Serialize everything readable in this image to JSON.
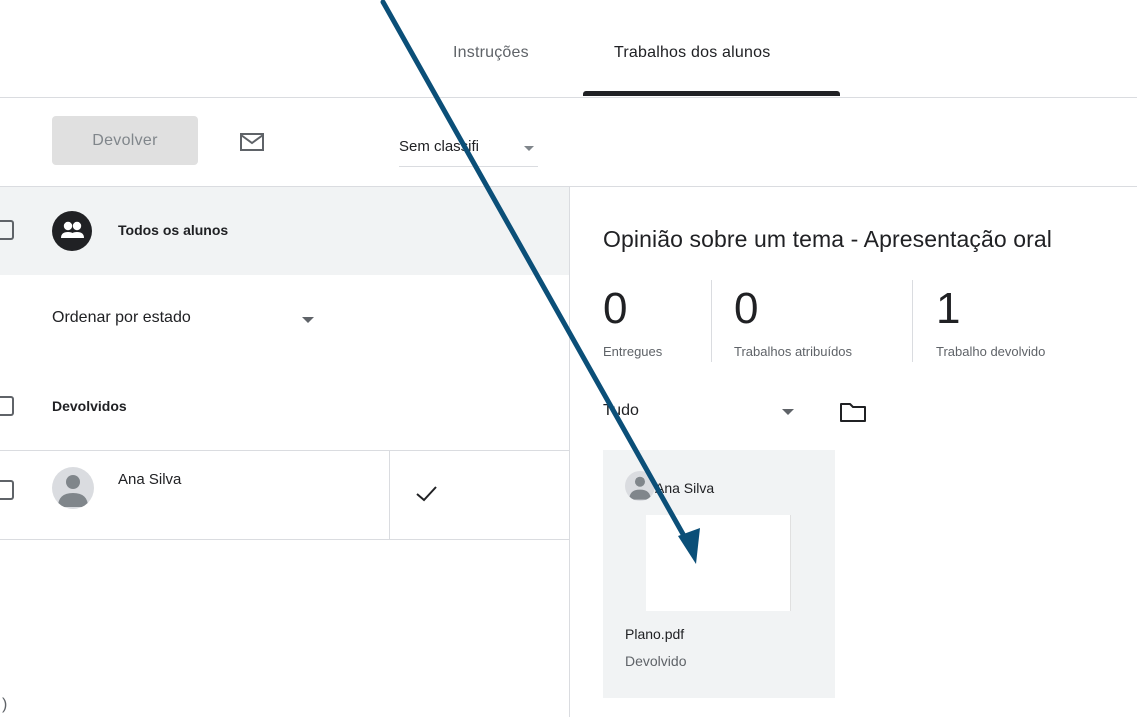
{
  "tabs": {
    "instructions": "Instruções",
    "student_work": "Trabalhos dos alunos"
  },
  "toolbar": {
    "return_label": "Devolver",
    "grade_filter": "Sem classifi"
  },
  "students_panel": {
    "all_students": "Todos os alunos",
    "sort_label": "Ordenar por estado",
    "section_returned": "Devolvidos",
    "students": [
      {
        "name": "Ana Silva",
        "status_icon": "check-icon"
      }
    ],
    "bottom_glyph": ")"
  },
  "assignment": {
    "title": "Opinião sobre um tema - Apresentação oral",
    "stats": [
      {
        "value": "0",
        "label": "Entregues"
      },
      {
        "value": "0",
        "label": "Trabalhos atribuídos"
      },
      {
        "value": "1",
        "label": "Trabalho devolvido"
      }
    ],
    "filter": "Tudo",
    "cards": [
      {
        "student": "Ana Silva",
        "file": "Plano.pdf",
        "status": "Devolvido"
      }
    ]
  },
  "colors": {
    "annotation_arrow": "#0b4f78",
    "accent_dark": "#202124"
  }
}
